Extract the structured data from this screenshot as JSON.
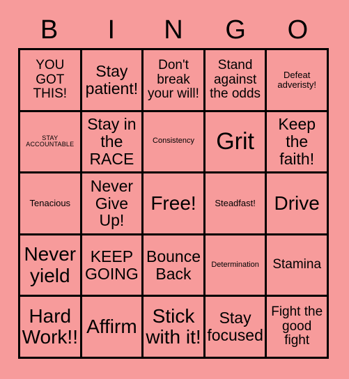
{
  "card": {
    "header_letters": [
      "B",
      "I",
      "N",
      "G",
      "O"
    ],
    "background_color": "#f79b9b",
    "border_color": "#000000",
    "text_color": "#000000",
    "rows": [
      [
        {
          "text": "YOU GOT THIS!",
          "size": "lg"
        },
        {
          "text": "Stay patient!",
          "size": "xl"
        },
        {
          "text": "Don't break your will!",
          "size": "lg"
        },
        {
          "text": "Stand against the odds",
          "size": "lg"
        },
        {
          "text": "Defeat adveristy!",
          "size": "md"
        }
      ],
      [
        {
          "text": "STAY ACCOUNTABLE",
          "size": "xs"
        },
        {
          "text": "Stay in the RACE",
          "size": "xl"
        },
        {
          "text": "Consistency",
          "size": "sm"
        },
        {
          "text": "Grit",
          "size": "3xl"
        },
        {
          "text": "Keep the faith!",
          "size": "xl"
        }
      ],
      [
        {
          "text": "Tenacious",
          "size": "md"
        },
        {
          "text": "Never Give Up!",
          "size": "xl"
        },
        {
          "text": "Free!",
          "size": "2xl"
        },
        {
          "text": "Steadfast!",
          "size": "md"
        },
        {
          "text": "Drive",
          "size": "2xl"
        }
      ],
      [
        {
          "text": "Never yield",
          "size": "2xl"
        },
        {
          "text": "KEEP GOING",
          "size": "xl"
        },
        {
          "text": "Bounce Back",
          "size": "xl"
        },
        {
          "text": "Determination",
          "size": "sm"
        },
        {
          "text": "Stamina",
          "size": "lg"
        }
      ],
      [
        {
          "text": "Hard Work!!",
          "size": "2xl"
        },
        {
          "text": "Affirm",
          "size": "2xl"
        },
        {
          "text": "Stick with it!",
          "size": "2xl"
        },
        {
          "text": "Stay focused",
          "size": "xl"
        },
        {
          "text": "Fight the good fight",
          "size": "lg"
        }
      ]
    ]
  }
}
